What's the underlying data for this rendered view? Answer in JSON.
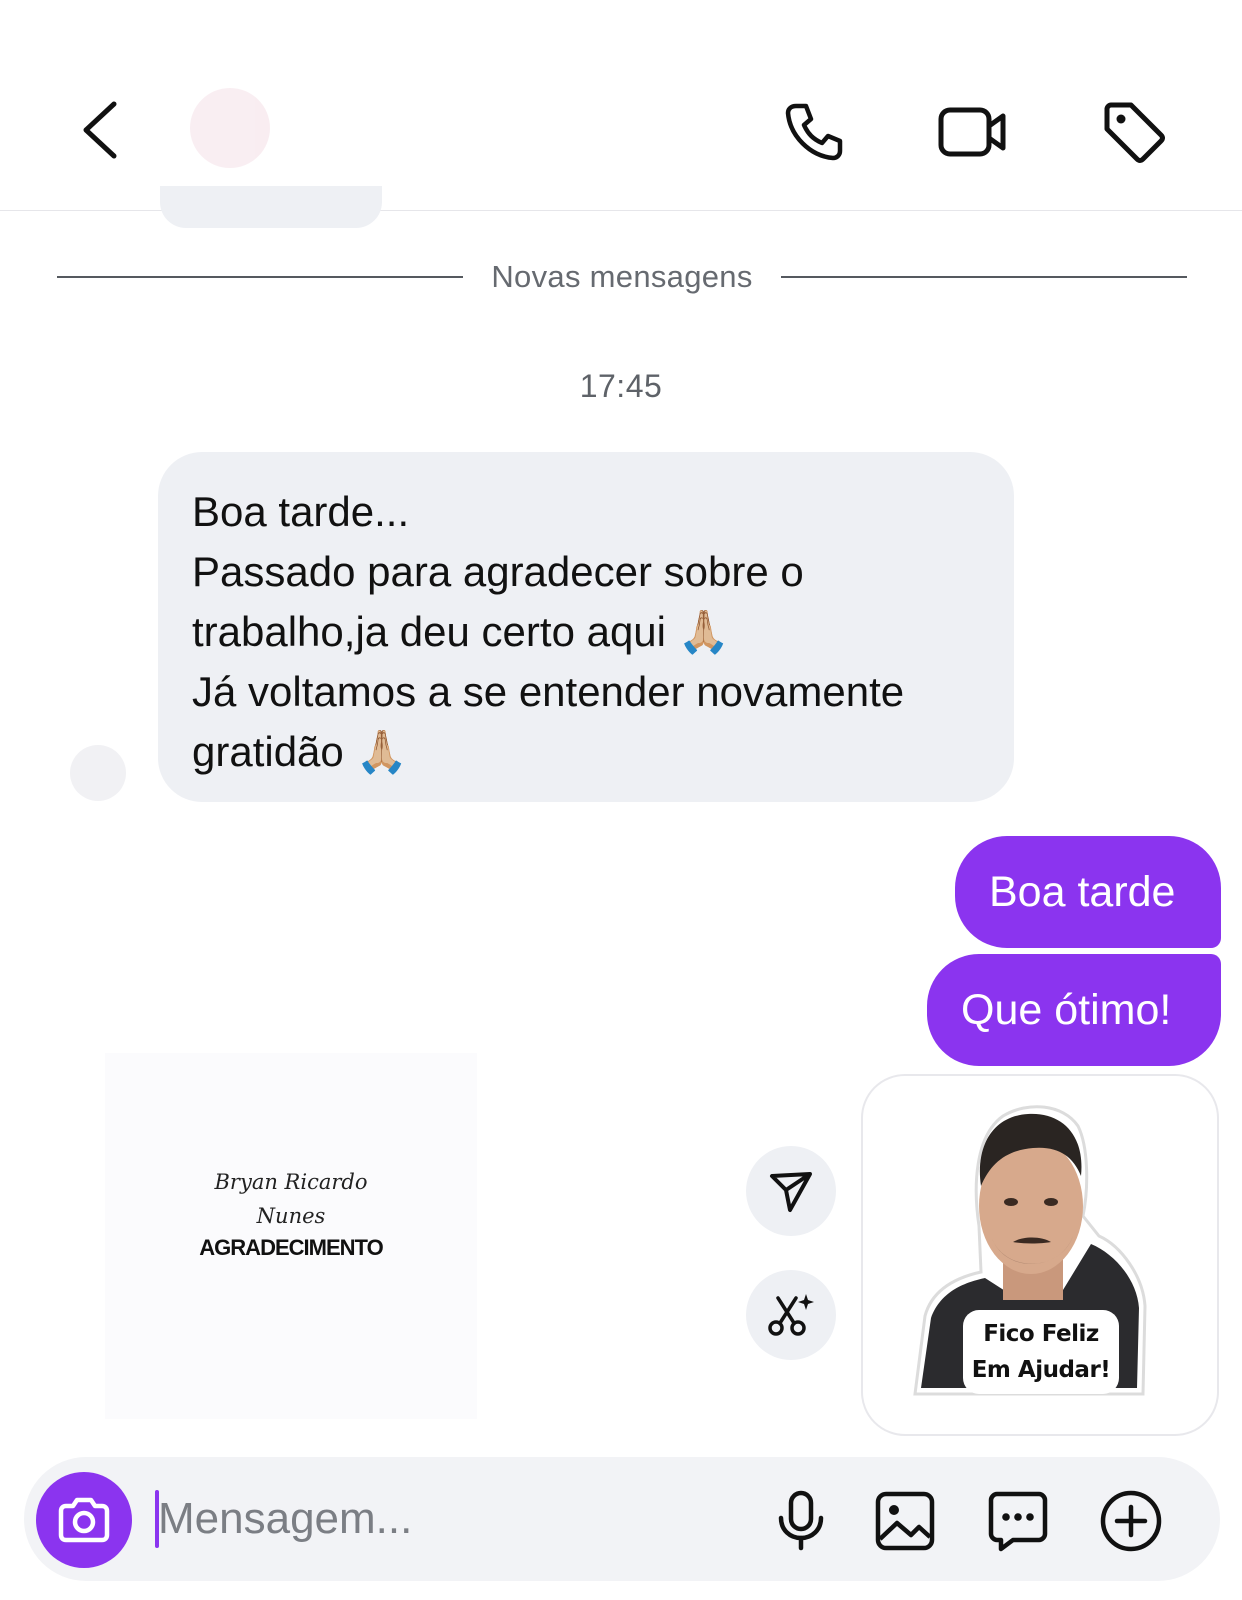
{
  "header": {
    "back_icon": "chevron-left-icon",
    "call_icon": "phone-icon",
    "video_icon": "video-camera-icon",
    "tag_icon": "tag-icon"
  },
  "chat": {
    "divider_label": "Novas mensagens",
    "timestamp": "17:45",
    "incoming": {
      "lines": [
        "Boa tarde...",
        "Passado para agradecer sobre o",
        "trabalho,ja deu certo aqui 🙏🏼",
        "Já voltamos a se entender novamente",
        "gratidão 🙏🏼"
      ]
    },
    "outgoing": [
      "Boa tarde",
      "Que ótimo!"
    ],
    "shared_post": {
      "script_name_line1": "Bryan Ricardo",
      "script_name_line2": "Nunes",
      "caption": "AGRADECIMENTO"
    },
    "sticker": {
      "line1": "Fico Feliz",
      "line2": "Em Ajudar!"
    }
  },
  "composer": {
    "placeholder": "Mensagem...",
    "icons": [
      "camera-icon",
      "microphone-icon",
      "gallery-icon",
      "sticker-icon",
      "plus-circle-icon"
    ]
  },
  "colors": {
    "accent": "#8b34ef",
    "incoming_bubble": "#eef0f4",
    "background": "#ffffff"
  }
}
